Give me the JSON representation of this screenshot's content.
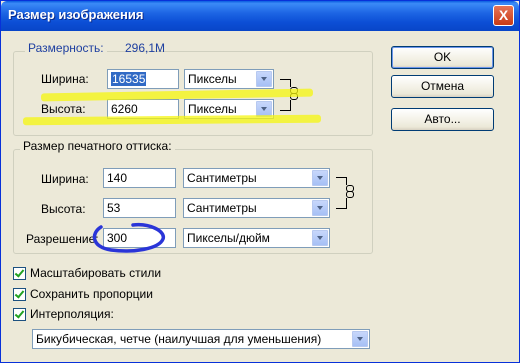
{
  "window": {
    "title": "Размер изображения",
    "close_label": "X"
  },
  "pixel_dimensions": {
    "label": "Размерность:",
    "value": "296,1M",
    "width_label": "Ширина:",
    "width_value": "16535",
    "width_unit": "Пикселы",
    "height_label": "Высота:",
    "height_value": "6260",
    "height_unit": "Пикселы"
  },
  "print_size": {
    "title": "Размер печатного оттиска:",
    "width_label": "Ширина:",
    "width_value": "140",
    "width_unit": "Сантиметры",
    "height_label": "Высота:",
    "height_value": "53",
    "height_unit": "Сантиметры",
    "resolution_label": "Разрешение:",
    "resolution_value": "300",
    "resolution_unit": "Пикселы/дюйм"
  },
  "buttons": {
    "ok": "OK",
    "cancel": "Отмена",
    "auto": "Авто..."
  },
  "options": {
    "scale_styles": "Масштабировать стили",
    "constrain": "Сохранить пропорции",
    "resample": "Интерполяция:",
    "resample_method": "Бикубическая, четче (наилучшая для уменьшения)"
  },
  "colors": {
    "titlebar": "#0c4fd6",
    "dialog_bg": "#ece9d8",
    "highlight_marker": "#f5f50f",
    "annotation_circle": "#2a35d8"
  }
}
